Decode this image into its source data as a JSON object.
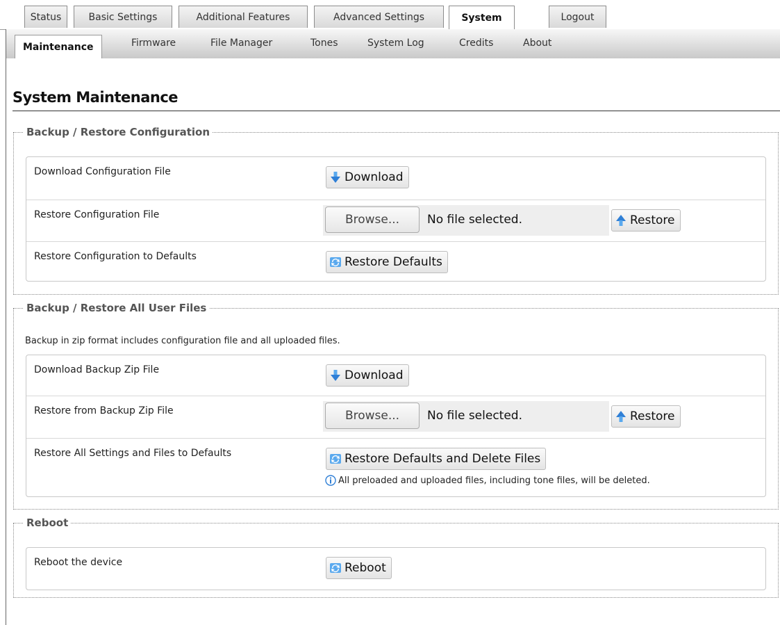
{
  "top_tabs": [
    "Status",
    "Basic Settings",
    "Additional Features",
    "Advanced Settings",
    "System",
    "Logout"
  ],
  "active_top_tab": "System",
  "sub_tabs": [
    "Maintenance",
    "Firmware",
    "File Manager",
    "Tones",
    "System Log",
    "Credits",
    "About"
  ],
  "active_sub_tab": "Maintenance",
  "page_title": "System Maintenance",
  "sections": {
    "config": {
      "legend": "Backup / Restore Configuration",
      "rows": [
        {
          "label": "Download Configuration File",
          "button": "Download"
        },
        {
          "label": "Restore Configuration File",
          "browse": "Browse...",
          "file_status": "No file selected.",
          "button": "Restore"
        },
        {
          "label": "Restore Configuration to Defaults",
          "button": "Restore Defaults"
        }
      ]
    },
    "userfiles": {
      "legend": "Backup / Restore All User Files",
      "note": "Backup in zip format includes configuration file and all uploaded files.",
      "rows": [
        {
          "label": "Download Backup Zip File",
          "button": "Download"
        },
        {
          "label": "Restore from Backup Zip File",
          "browse": "Browse...",
          "file_status": "No file selected.",
          "button": "Restore"
        },
        {
          "label": "Restore All Settings and Files to Defaults",
          "button": "Restore Defaults and Delete Files",
          "warning": "All preloaded and uploaded files, including tone files, will be deleted."
        }
      ]
    },
    "reboot": {
      "legend": "Reboot",
      "rows": [
        {
          "label": "Reboot the device",
          "button": "Reboot"
        }
      ]
    }
  },
  "colors": {
    "icon_blue": "#2f7fd6",
    "icon_arrow_light": "#5aa9ee",
    "border": "#8c8c8c"
  },
  "icons": {
    "download": "download-arrow-icon",
    "restore": "upload-arrow-icon",
    "defaults": "refresh-icon",
    "info": "info-icon"
  }
}
